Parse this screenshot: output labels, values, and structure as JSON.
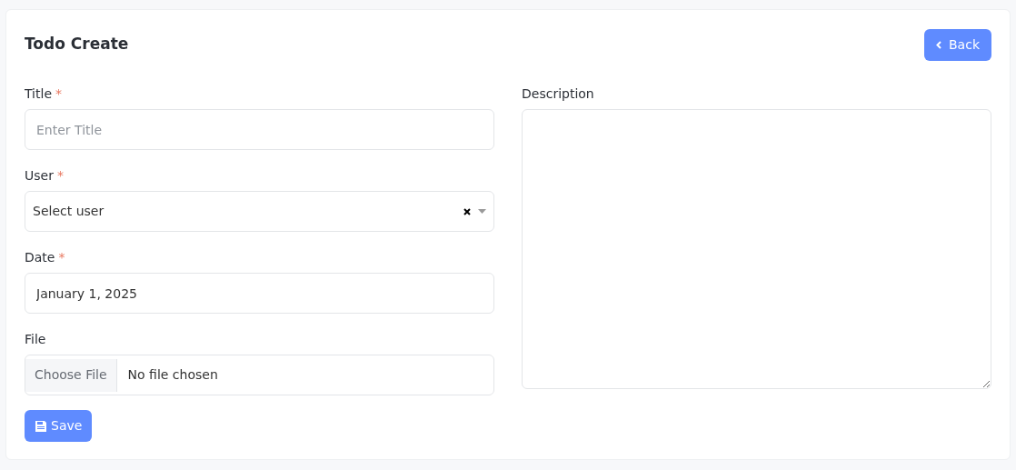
{
  "page_title": "Todo Create",
  "back_button": {
    "label": "Back"
  },
  "left_fields": [
    {
      "kind": "text",
      "label": "Title",
      "required_mark": "*",
      "placeholder": "Enter Title"
    },
    {
      "kind": "select",
      "label": "User",
      "required_mark": "*",
      "value": "Select user"
    },
    {
      "kind": "text",
      "label": "Date",
      "required_mark": "*",
      "value": "January 1, 2025"
    },
    {
      "kind": "file",
      "label": "File",
      "button": "Choose File",
      "value": "No file chosen"
    }
  ],
  "right_fields": [
    {
      "kind": "textarea",
      "label": "Description"
    }
  ],
  "save_button": {
    "label": "Save"
  }
}
